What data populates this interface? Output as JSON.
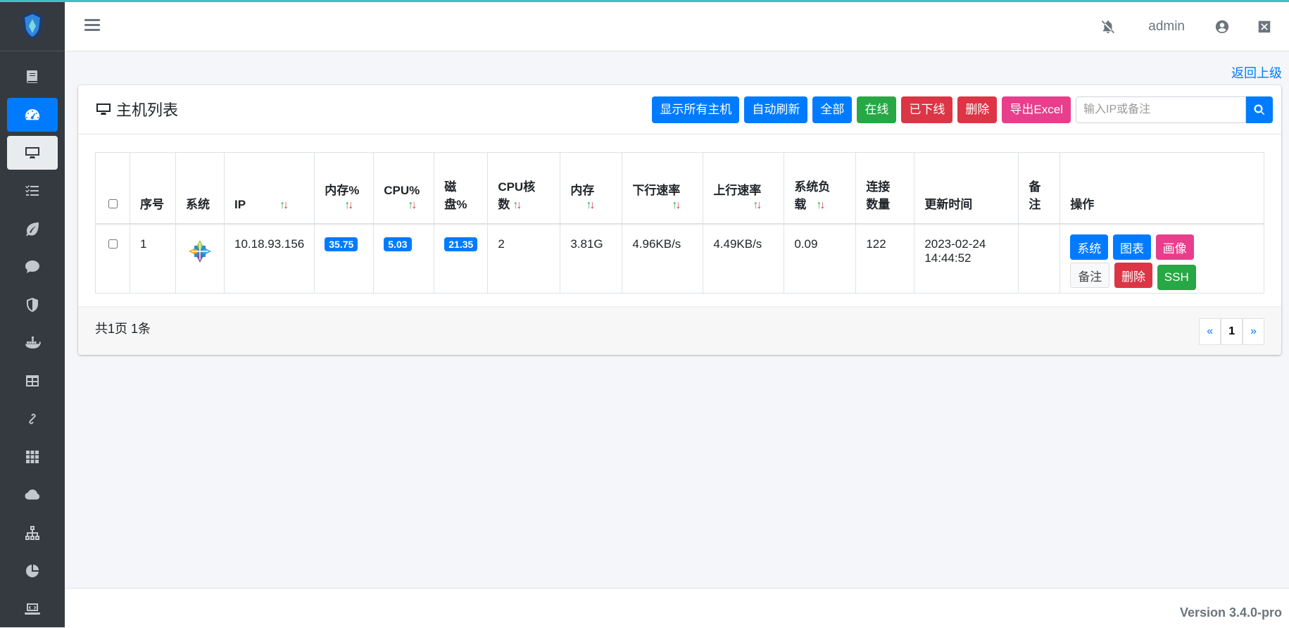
{
  "header": {
    "user": "admin"
  },
  "back_link": "返回上级",
  "card": {
    "title": "主机列表",
    "buttons": {
      "show_all": "显示所有主机",
      "auto_refresh": "自动刷新",
      "all": "全部",
      "online": "在线",
      "offline": "已下线",
      "delete": "删除",
      "export": "导出Excel"
    },
    "search_placeholder": "输入IP或备注"
  },
  "table": {
    "columns": {
      "index": "序号",
      "system": "系统",
      "ip": "IP",
      "mem_pct": "内存%",
      "cpu_pct": "CPU%",
      "disk_pct_1": "磁",
      "disk_pct_2": "盘%",
      "cpu_cores_1": "CPU核",
      "cpu_cores_2": "数",
      "memory": "内存",
      "down_rate": "下行速率",
      "up_rate": "上行速率",
      "load_1": "系统负",
      "load_2": "载",
      "conn_1": "连接",
      "conn_2": "数量",
      "update_time": "更新时间",
      "note_1": "备",
      "note_2": "注",
      "actions": "操作"
    },
    "sort_up": "↑",
    "sort_down": "↓",
    "rows": [
      {
        "index": "1",
        "system_icon": "centos-icon",
        "ip": "10.18.93.156",
        "mem_pct": "35.75",
        "cpu_pct": "5.03",
        "disk_pct": "21.35",
        "cpu_cores": "2",
        "memory": "3.81G",
        "down_rate": "4.96KB/s",
        "up_rate": "4.49KB/s",
        "load": "0.09",
        "connections": "122",
        "update_date": "2023-02-24",
        "update_clock": "14:44:52",
        "note": "",
        "actions": {
          "system": "系统",
          "chart": "图表",
          "portrait": "画像",
          "note": "备注",
          "delete": "删除",
          "ssh": "SSH"
        }
      }
    ]
  },
  "pagination": {
    "info": "共1页 1条",
    "prev": "«",
    "current": "1",
    "next": "»"
  },
  "footer": {
    "version": "Version 3.4.0-pro"
  },
  "colors": {
    "primary": "#007bff",
    "success": "#28a745",
    "danger": "#dc3545",
    "pink": "#e83e8c",
    "sidebar": "#343a40"
  }
}
